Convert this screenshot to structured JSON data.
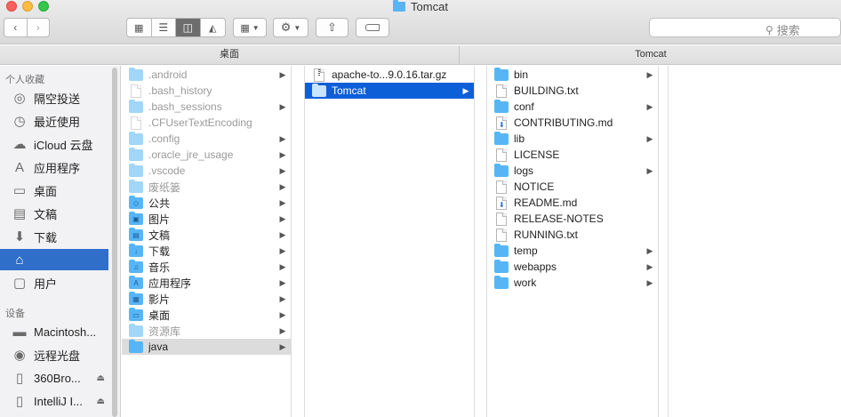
{
  "window": {
    "title": "Tomcat"
  },
  "toolbar": {
    "back_icon": "chevron-left-icon",
    "forward_icon": "chevron-right-icon",
    "search_placeholder": "搜索"
  },
  "pathbar": {
    "left": "桌面",
    "right": "Tomcat"
  },
  "sidebar": {
    "favorites_header": "个人收藏",
    "favorites": [
      {
        "label": "隔空投送",
        "icon": "airdrop-icon"
      },
      {
        "label": "最近使用",
        "icon": "recents-icon"
      },
      {
        "label": "iCloud 云盘",
        "icon": "icloud-icon"
      },
      {
        "label": "应用程序",
        "icon": "applications-icon"
      },
      {
        "label": "桌面",
        "icon": "desktop-icon"
      },
      {
        "label": "文稿",
        "icon": "documents-icon"
      },
      {
        "label": "下载",
        "icon": "downloads-icon"
      },
      {
        "label": "",
        "icon": "home-icon",
        "selected": true
      },
      {
        "label": "用户",
        "icon": "users-folder-icon"
      }
    ],
    "devices_header": "设备",
    "devices": [
      {
        "label": "Macintosh...",
        "icon": "hard-drive-icon"
      },
      {
        "label": "远程光盘",
        "icon": "remote-disc-icon"
      },
      {
        "label": "360Bro...",
        "icon": "external-drive-icon",
        "eject": true
      },
      {
        "label": "IntelliJ I...",
        "icon": "external-drive-icon",
        "eject": true
      }
    ]
  },
  "columns": {
    "home": [
      {
        "name": ".android",
        "kind": "folder",
        "hidden": true,
        "arrow": true
      },
      {
        "name": ".bash_history",
        "kind": "file",
        "hidden": true
      },
      {
        "name": ".bash_sessions",
        "kind": "folder",
        "hidden": true,
        "arrow": true
      },
      {
        "name": ".CFUserTextEncoding",
        "kind": "file",
        "hidden": true
      },
      {
        "name": ".config",
        "kind": "folder",
        "hidden": true,
        "arrow": true
      },
      {
        "name": ".oracle_jre_usage",
        "kind": "folder",
        "hidden": true,
        "arrow": true
      },
      {
        "name": ".vscode",
        "kind": "folder",
        "hidden": true,
        "arrow": true
      },
      {
        "name": "废纸篓",
        "kind": "folder",
        "hidden": true,
        "arrow": true
      },
      {
        "name": "公共",
        "kind": "folder",
        "arrow": true,
        "glyph": "◇"
      },
      {
        "name": "图片",
        "kind": "folder",
        "arrow": true,
        "glyph": "▣"
      },
      {
        "name": "文稿",
        "kind": "folder",
        "arrow": true,
        "glyph": "▤"
      },
      {
        "name": "下载",
        "kind": "folder",
        "arrow": true,
        "glyph": "↓"
      },
      {
        "name": "音乐",
        "kind": "folder",
        "arrow": true,
        "glyph": "♫"
      },
      {
        "name": "应用程序",
        "kind": "folder",
        "arrow": true,
        "glyph": "A"
      },
      {
        "name": "影片",
        "kind": "folder",
        "arrow": true,
        "glyph": "▦"
      },
      {
        "name": "桌面",
        "kind": "folder",
        "arrow": true,
        "glyph": "▭"
      },
      {
        "name": "资源库",
        "kind": "folder",
        "hidden": true,
        "arrow": true
      },
      {
        "name": "java",
        "kind": "folder",
        "arrow": true,
        "selected": "gray"
      }
    ],
    "java": [
      {
        "name": "apache-to...9.0.16.tar.gz",
        "kind": "archive"
      },
      {
        "name": "Tomcat",
        "kind": "folder",
        "arrow": true,
        "selected": "blue"
      }
    ],
    "tomcat": [
      {
        "name": "bin",
        "kind": "folder",
        "arrow": true
      },
      {
        "name": "BUILDING.txt",
        "kind": "file"
      },
      {
        "name": "conf",
        "kind": "folder",
        "arrow": true
      },
      {
        "name": "CONTRIBUTING.md",
        "kind": "md"
      },
      {
        "name": "lib",
        "kind": "folder",
        "arrow": true
      },
      {
        "name": "LICENSE",
        "kind": "file"
      },
      {
        "name": "logs",
        "kind": "folder",
        "arrow": true
      },
      {
        "name": "NOTICE",
        "kind": "file"
      },
      {
        "name": "README.md",
        "kind": "md"
      },
      {
        "name": "RELEASE-NOTES",
        "kind": "file"
      },
      {
        "name": "RUNNING.txt",
        "kind": "file"
      },
      {
        "name": "temp",
        "kind": "folder",
        "arrow": true
      },
      {
        "name": "webapps",
        "kind": "folder",
        "arrow": true
      },
      {
        "name": "work",
        "kind": "folder",
        "arrow": true
      }
    ]
  }
}
